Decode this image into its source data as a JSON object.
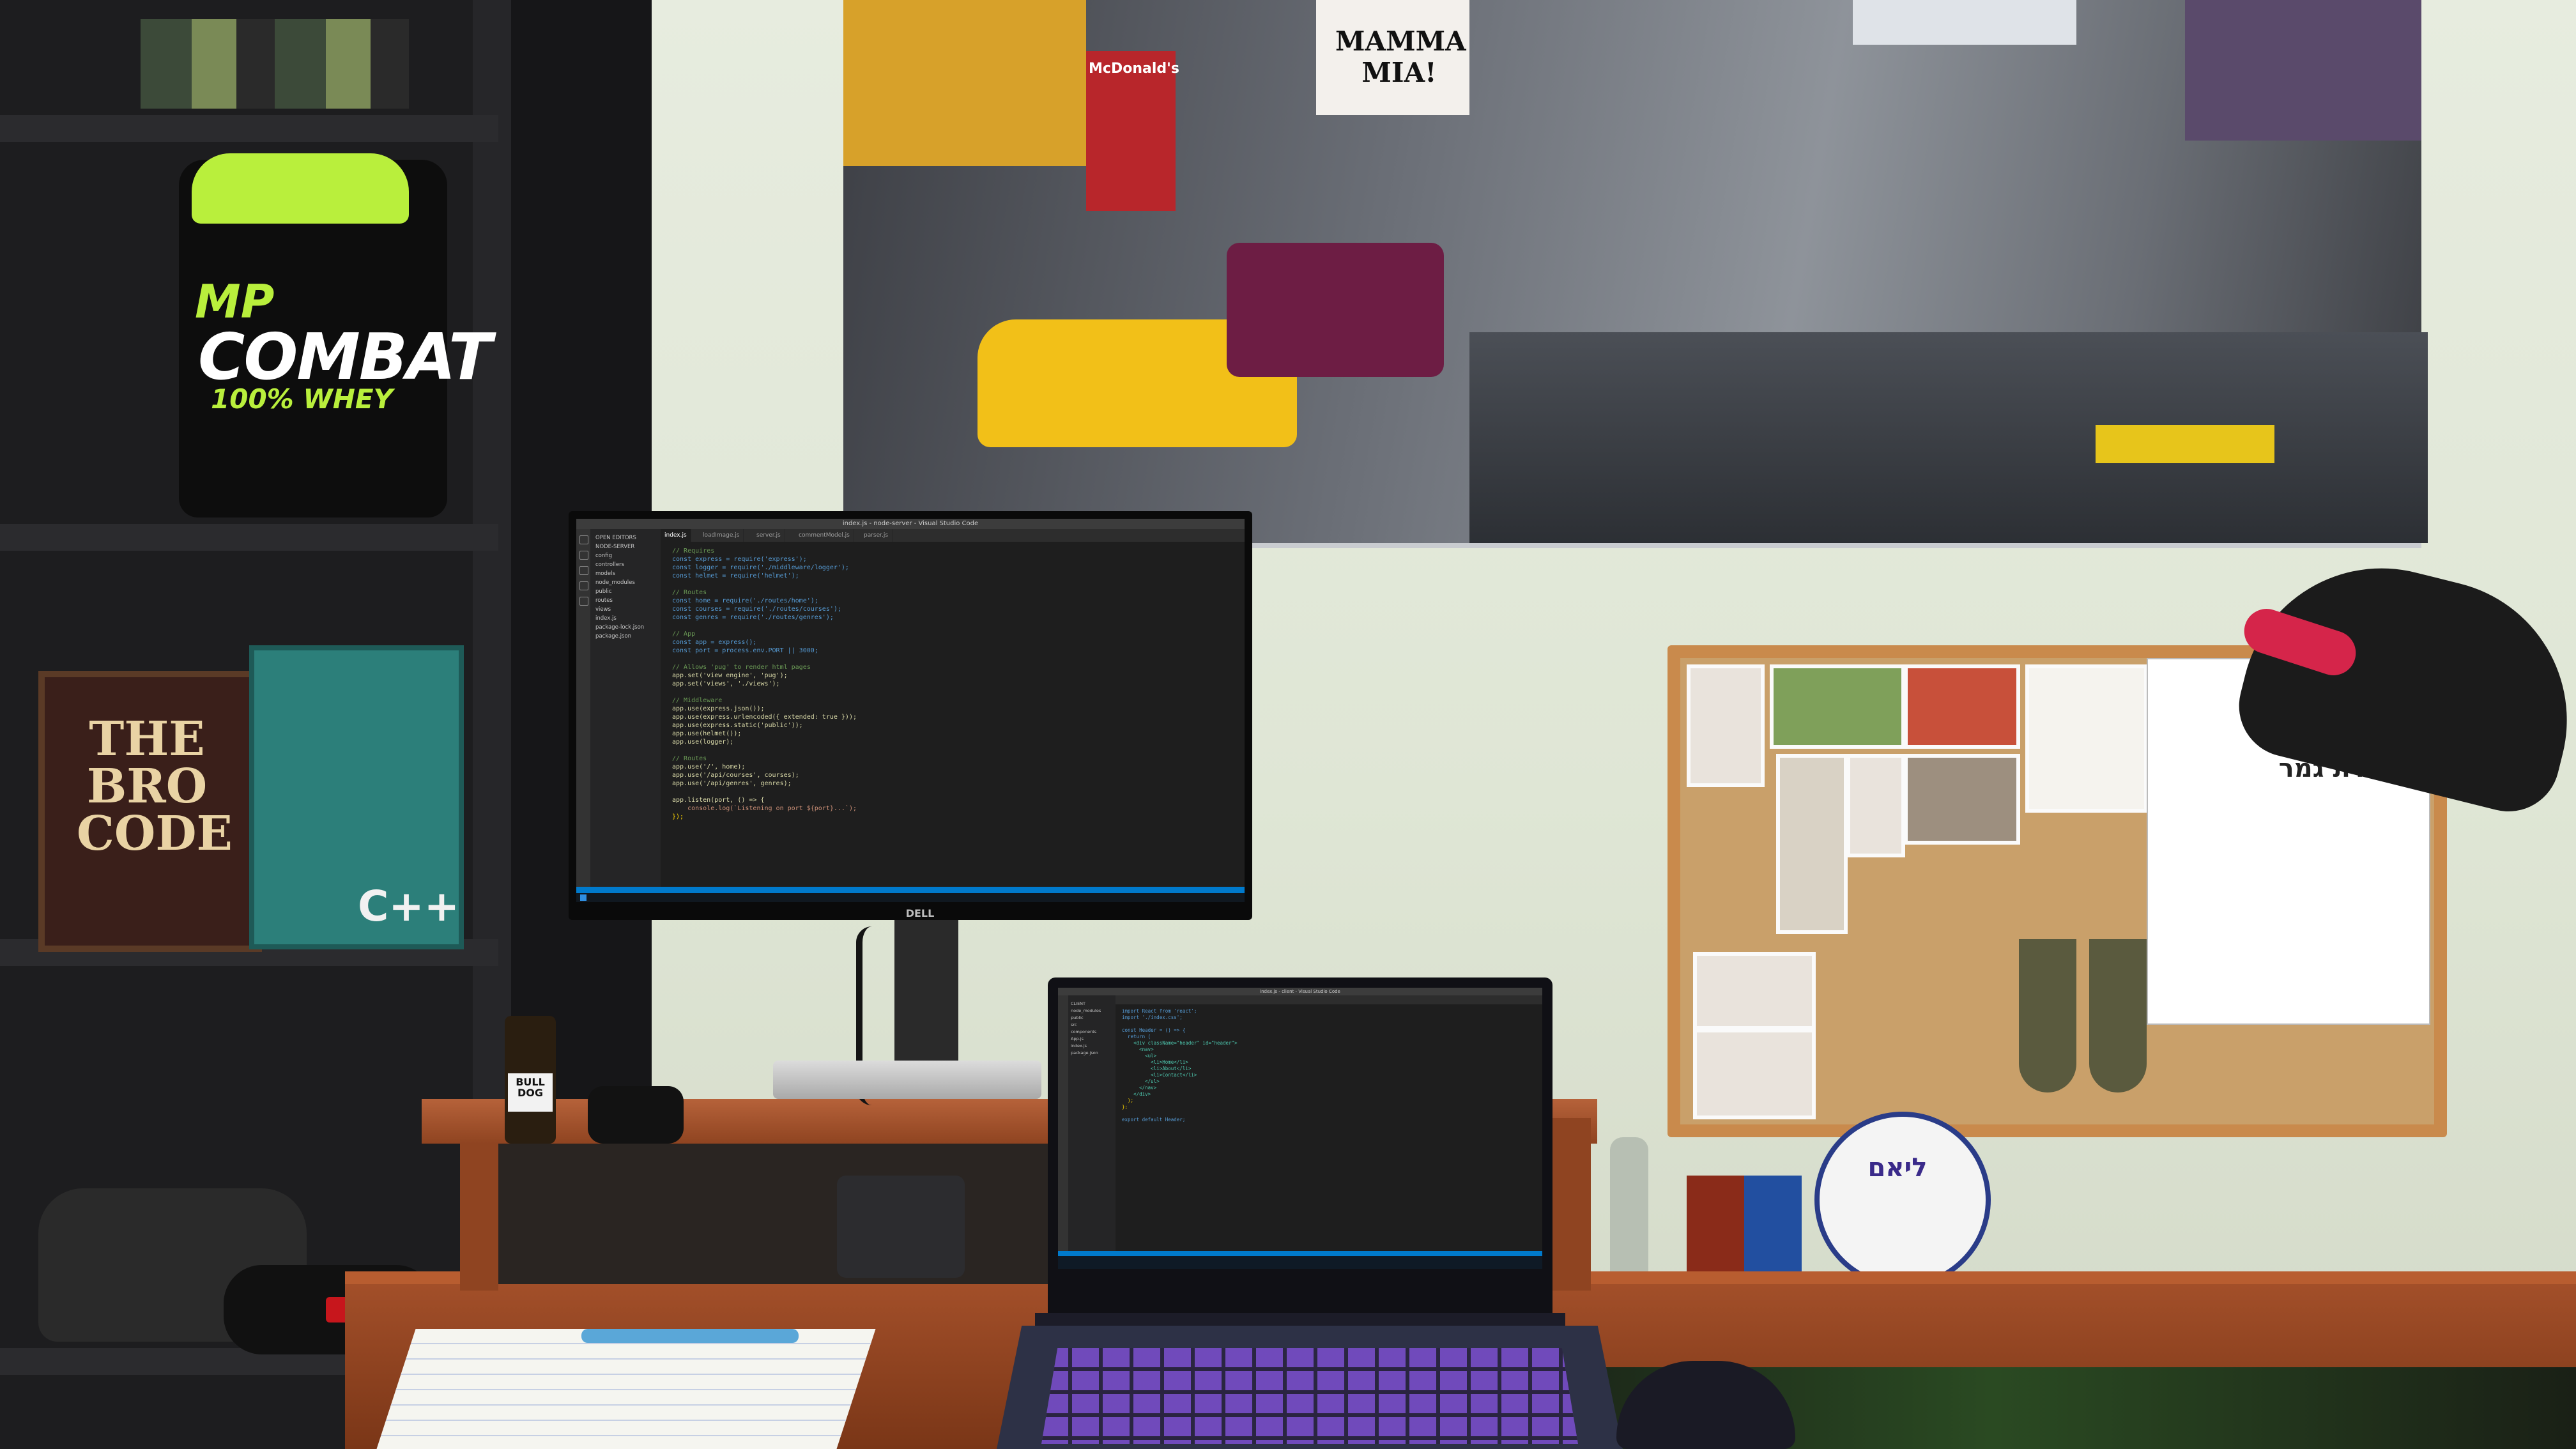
{
  "scene": {
    "description_labels": {
      "tub_brand_top": "MP",
      "tub_brand": "COMBAT",
      "tub_sub": "100% WHEY",
      "book_left_title": "THE BRO CODE",
      "book_right_title": "C++",
      "poster_show": "MAMMA MIA!",
      "poster_restaurant": "McDonald's",
      "diploma_title": "תעודת גמר",
      "plaque_title": "ליאם",
      "bottle_label": "BULL DOG",
      "monitor_brand": "DELL"
    }
  },
  "monitor": {
    "title_bar": "index.js - node-server - Visual Studio Code",
    "tabs": [
      "index.js",
      "loadImage.js",
      "server.js",
      "commentModel.js",
      "parser.js"
    ],
    "active_tab": "index.js",
    "explorer": [
      "OPEN EDITORS",
      "NODE-SERVER",
      "config",
      "controllers",
      "models",
      "node_modules",
      "public",
      "routes",
      "views",
      "index.js",
      "package-lock.json",
      "package.json"
    ],
    "code": [
      {
        "t": "// Requires",
        "c": "cm"
      },
      {
        "t": "const express = require('express');",
        "c": "kw"
      },
      {
        "t": "const logger = require('./middleware/logger');",
        "c": "kw"
      },
      {
        "t": "const helmet = require('helmet');",
        "c": "kw"
      },
      {
        "t": "",
        "c": ""
      },
      {
        "t": "// Routes",
        "c": "cm"
      },
      {
        "t": "const home = require('./routes/home');",
        "c": "kw"
      },
      {
        "t": "const courses = require('./routes/courses');",
        "c": "kw"
      },
      {
        "t": "const genres = require('./routes/genres');",
        "c": "kw"
      },
      {
        "t": "",
        "c": ""
      },
      {
        "t": "// App",
        "c": "cm"
      },
      {
        "t": "const app = express();",
        "c": "kw"
      },
      {
        "t": "const port = process.env.PORT || 3000;",
        "c": "kw"
      },
      {
        "t": "",
        "c": ""
      },
      {
        "t": "// Allows 'pug' to render html pages",
        "c": "cm"
      },
      {
        "t": "app.set('view engine', 'pug');",
        "c": "fn"
      },
      {
        "t": "app.set('views', './views');",
        "c": "fn"
      },
      {
        "t": "",
        "c": ""
      },
      {
        "t": "// Middleware",
        "c": "cm"
      },
      {
        "t": "app.use(express.json());",
        "c": "fn"
      },
      {
        "t": "app.use(express.urlencoded({ extended: true }));",
        "c": "fn"
      },
      {
        "t": "app.use(express.static('public'));",
        "c": "fn"
      },
      {
        "t": "app.use(helmet());",
        "c": "fn"
      },
      {
        "t": "app.use(logger);",
        "c": "fn"
      },
      {
        "t": "",
        "c": ""
      },
      {
        "t": "// Routes",
        "c": "cm"
      },
      {
        "t": "app.use('/', home);",
        "c": "fn"
      },
      {
        "t": "app.use('/api/courses', courses);",
        "c": "fn"
      },
      {
        "t": "app.use('/api/genres', genres);",
        "c": "fn"
      },
      {
        "t": "",
        "c": ""
      },
      {
        "t": "app.listen(port, () => {",
        "c": "fn"
      },
      {
        "t": "    console.log(`Listening on port ${port}...`);",
        "c": "str"
      },
      {
        "t": "});",
        "c": "pun"
      }
    ]
  },
  "laptop": {
    "title_bar": "index.js - client - Visual Studio Code",
    "explorer": [
      "CLIENT",
      "node_modules",
      "public",
      "src",
      "components",
      "App.js",
      "index.js",
      "package.json"
    ],
    "code": [
      {
        "t": "import React from 'react';",
        "c": "kw"
      },
      {
        "t": "import './index.css';",
        "c": "kw"
      },
      {
        "t": "",
        "c": ""
      },
      {
        "t": "const Header = () => {",
        "c": "kw"
      },
      {
        "t": "  return (",
        "c": "kw"
      },
      {
        "t": "    <div className=\"header\" id=\"header\">",
        "c": "tag"
      },
      {
        "t": "      <nav>",
        "c": "tag"
      },
      {
        "t": "        <ul>",
        "c": "tag"
      },
      {
        "t": "          <li>Home</li>",
        "c": "tag"
      },
      {
        "t": "          <li>About</li>",
        "c": "tag"
      },
      {
        "t": "          <li>Contact</li>",
        "c": "tag"
      },
      {
        "t": "        </ul>",
        "c": "tag"
      },
      {
        "t": "      </nav>",
        "c": "tag"
      },
      {
        "t": "    </div>",
        "c": "tag"
      },
      {
        "t": "  );",
        "c": "pun"
      },
      {
        "t": "};",
        "c": "pun"
      },
      {
        "t": "",
        "c": ""
      },
      {
        "t": "export default Header;",
        "c": "kw"
      }
    ]
  }
}
